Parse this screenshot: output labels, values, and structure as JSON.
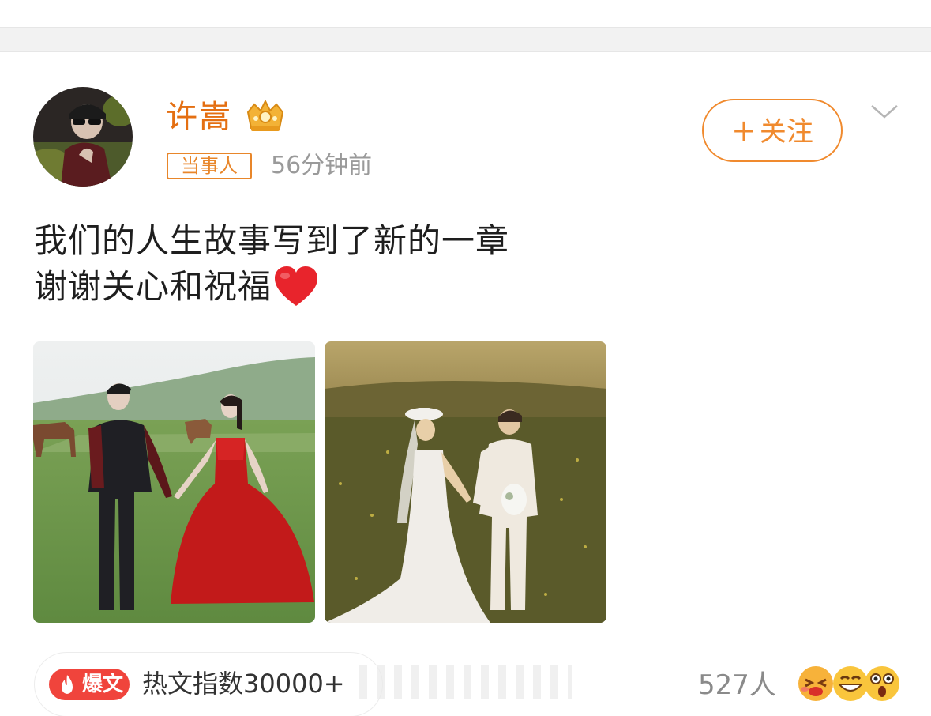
{
  "post": {
    "author": {
      "name": "许嵩",
      "role_tag": "当事人",
      "time": "56分钟前"
    },
    "follow_button": {
      "label": "关注",
      "plus": "+"
    },
    "text_lines": [
      "我们的人生故事写到了新的一章",
      "谢谢关心和祝福"
    ],
    "images": [
      {
        "name": "photo-red-gown-couple"
      },
      {
        "name": "photo-white-gown-couple"
      }
    ],
    "hot": {
      "badge_label": "爆文",
      "index_text": "热文指数30000+"
    },
    "reactions": {
      "count_text": "527人",
      "emoji_icons": [
        "squint-laugh-icon",
        "grin-icon",
        "shocked-icon"
      ]
    }
  },
  "colors": {
    "accent_orange": "#e46f12",
    "follow_orange": "#f08a2e",
    "hot_red": "#f0443c",
    "muted_gray": "#9a9a9a"
  }
}
